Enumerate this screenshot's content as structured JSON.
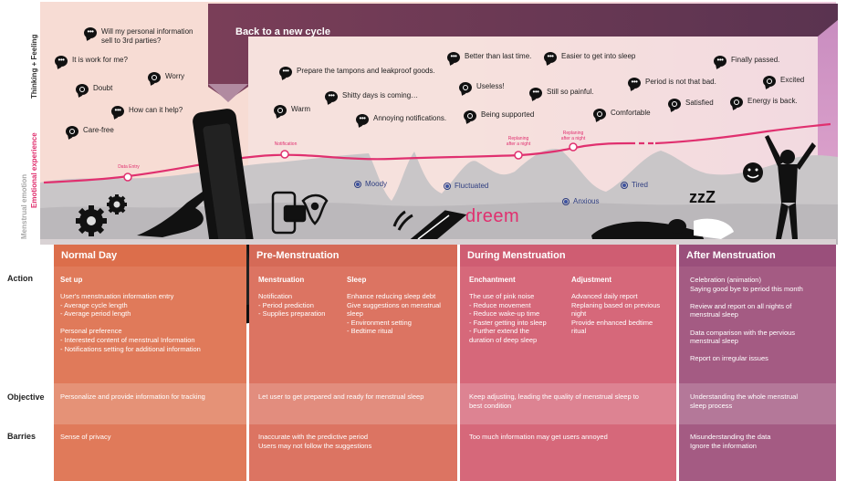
{
  "banner": {
    "title": "Back to a new cycle"
  },
  "side_labels": {
    "thinking": "Thinking + Feeling",
    "emotional": "Emotional experience",
    "menstrual": "Menstrual emotion"
  },
  "row_labels": {
    "action": "Action",
    "objective": "Objective",
    "barriers": "Barries"
  },
  "brand": "dreem",
  "thoughts": [
    {
      "text": "Will my personal information\nsell to 3rd parties?",
      "icon": "speech-bubble-icon"
    },
    {
      "text": "It is work for me?",
      "icon": "speech-bubble-icon"
    },
    {
      "text": "Worry",
      "icon": "heart-bubble-icon"
    },
    {
      "text": "Doubt",
      "icon": "heart-bubble-icon"
    },
    {
      "text": "How can it help?",
      "icon": "speech-bubble-icon"
    },
    {
      "text": "Care-free",
      "icon": "heart-bubble-icon"
    },
    {
      "text": "Prepare the tampons and leakproof goods.",
      "icon": "speech-bubble-icon"
    },
    {
      "text": "Shitty days is coming…",
      "icon": "speech-bubble-icon"
    },
    {
      "text": "Warm",
      "icon": "heart-bubble-icon"
    },
    {
      "text": "Annoying notifications.",
      "icon": "speech-bubble-icon"
    },
    {
      "text": "Better than last time.",
      "icon": "speech-bubble-icon"
    },
    {
      "text": "Easier to get into sleep",
      "icon": "speech-bubble-icon"
    },
    {
      "text": "Useless!",
      "icon": "heart-bubble-icon"
    },
    {
      "text": "Still so painful.",
      "icon": "speech-bubble-icon"
    },
    {
      "text": "Being supported",
      "icon": "heart-bubble-icon"
    },
    {
      "text": "Comfortable",
      "icon": "heart-bubble-icon"
    },
    {
      "text": "Finally passed.",
      "icon": "speech-bubble-icon"
    },
    {
      "text": "Period is not that bad.",
      "icon": "speech-bubble-icon"
    },
    {
      "text": "Excited",
      "icon": "heart-bubble-icon"
    },
    {
      "text": "Satisfied",
      "icon": "heart-bubble-icon"
    },
    {
      "text": "Energy is back.",
      "icon": "heart-bubble-icon"
    }
  ],
  "curve_points": [
    {
      "label": "Data Entry"
    },
    {
      "label": "Notification"
    },
    {
      "label": "Replaning\nafter a night"
    },
    {
      "label": "Replaning\nafter a night"
    }
  ],
  "moods": [
    "Moody",
    "Fluctuated",
    "Anxious",
    "Tired"
  ],
  "columns": [
    {
      "title": "Normal Day",
      "color": "#e07a5a",
      "head_color": "#dc6e4b",
      "action": [
        {
          "heading": "Set up",
          "body": "User's menstruation information entry\n - Average cycle length\n - Average period length\n\nPersonal preference\n - Interested content of menstrual Information\n - Notifications setting for additional information"
        }
      ],
      "objective": "Personalize and provide information for tracking",
      "barriers": "Sense of privacy"
    },
    {
      "title": "Pre-Menstruation",
      "color": "#dc7462",
      "head_color": "#d56a57",
      "action": [
        {
          "heading": "Menstruation",
          "body": "Notification\n - Period prediction\n - Supplies preparation"
        },
        {
          "heading": "Sleep",
          "body": "Enhance reducing sleep debt\nGive suggestions on menstrual\nsleep\n - Environment setting\n - Bedtime ritual"
        }
      ],
      "objective": "Let user to get prepared and ready for menstrual sleep",
      "barriers": "Inaccurate with the predictive period\nUsers may not follow the suggestions"
    },
    {
      "title": "During Menstruation",
      "color": "#d6687a",
      "head_color": "#cf5d72",
      "action": [
        {
          "heading": "Enchantment",
          "body": "The use of pink noise\n - Reduce movement\n - Reduce wake-up time\n - Faster getting into sleep\n - Further extend the\n   duration of deep sleep"
        },
        {
          "heading": "Adjustment",
          "body": "Advanced daily report\nReplaning based on previous\nnight\nProvide enhanced bedtime\nritual"
        }
      ],
      "objective": "Keep adjusting, leading the quality of menstrual sleep to\nbest condition",
      "barriers": "Too much information may get users annoyed"
    },
    {
      "title": "After Menstruation",
      "color": "#a45b83",
      "head_color": "#9a4f7b",
      "action": [
        {
          "heading": "",
          "body": "Celebration (animation)\nSaying good bye to period this month\n\nReview and report on all nights of\nmenstrual sleep\n\nData comparison with the pervious\nmenstrual sleep\n\nReport on irregular issues"
        }
      ],
      "objective": "Understanding the whole menstrual\nsleep process",
      "barriers": "Misunderstanding the data\nIgnore the information"
    }
  ]
}
